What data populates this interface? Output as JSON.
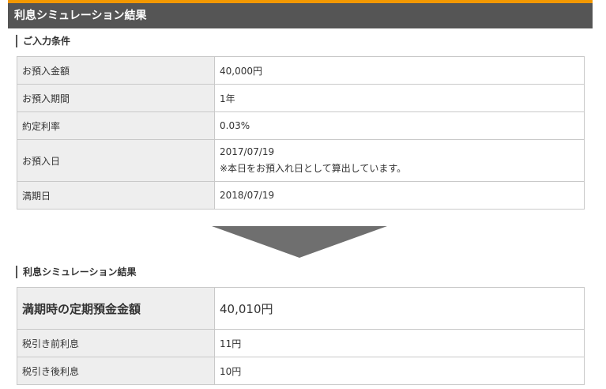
{
  "header": {
    "title": "利息シミュレーション結果"
  },
  "conditions": {
    "title": "ご入力条件",
    "rows": [
      {
        "label": "お預入金額",
        "value": "40,000円"
      },
      {
        "label": "お預入期間",
        "value": "1年"
      },
      {
        "label": "約定利率",
        "value": "0.03%"
      },
      {
        "label": "お預入日",
        "value": "2017/07/19",
        "note": "※本日をお預入れ日として算出しています。"
      },
      {
        "label": "満期日",
        "value": "2018/07/19"
      }
    ]
  },
  "results": {
    "title": "利息シミュレーション結果",
    "main": {
      "label": "満期時の定期預金金額",
      "value": "40,010円"
    },
    "rows": [
      {
        "label": "税引き前利息",
        "value": "11円"
      },
      {
        "label": "税引き後利息",
        "value": "10円"
      }
    ]
  },
  "colors": {
    "accent": "#f39800",
    "header_bg": "#555555",
    "label_bg": "#eeeeee",
    "result_label_bg": "#fffbe6",
    "arrow": "#6f6f6f"
  }
}
